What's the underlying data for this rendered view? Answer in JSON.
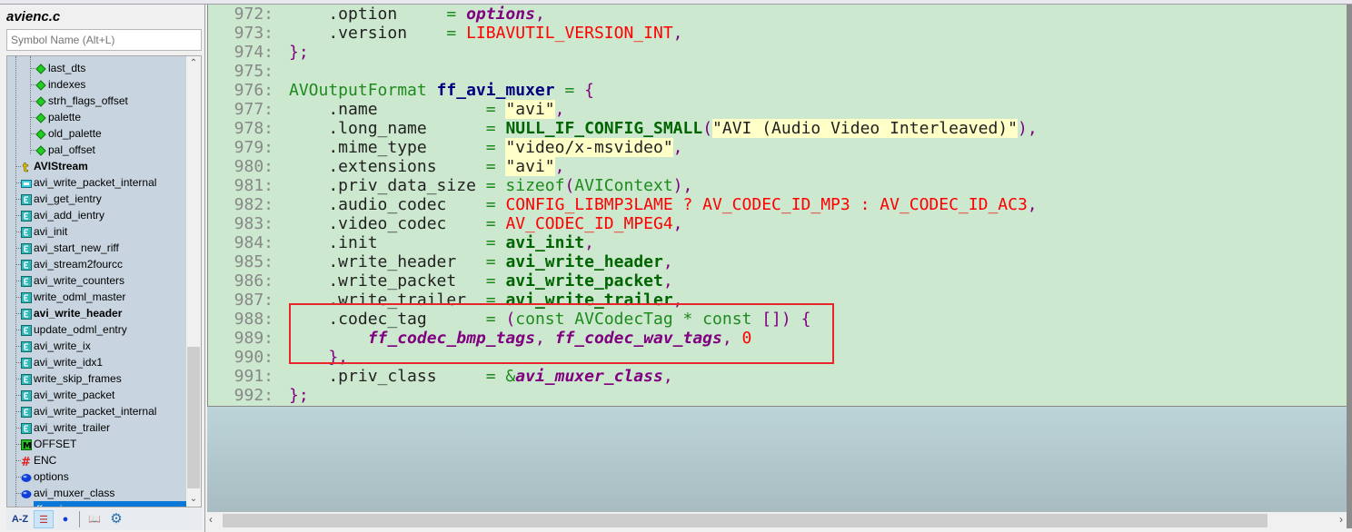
{
  "sidebar": {
    "file_title": "avienc.c",
    "search_placeholder": "Symbol Name (Alt+L)",
    "items": [
      {
        "label": "last_dts",
        "icon": "member-diamond-icon",
        "level": 2
      },
      {
        "label": "indexes",
        "icon": "member-diamond-icon",
        "level": 2
      },
      {
        "label": "strh_flags_offset",
        "icon": "member-diamond-icon",
        "level": 2
      },
      {
        "label": "palette",
        "icon": "member-diamond-icon",
        "level": 2
      },
      {
        "label": "old_palette",
        "icon": "member-diamond-icon",
        "level": 2
      },
      {
        "label": "pal_offset",
        "icon": "member-diamond-icon",
        "level": 2
      },
      {
        "label": "AVIStream",
        "icon": "struct-icon",
        "level": 1,
        "bold": true
      },
      {
        "label": "avi_write_packet_internal",
        "icon": "function-prototype-icon",
        "level": 1
      },
      {
        "label": "avi_get_ientry",
        "icon": "function-icon",
        "level": 1
      },
      {
        "label": "avi_add_ientry",
        "icon": "function-icon",
        "level": 1
      },
      {
        "label": "avi_init",
        "icon": "function-icon",
        "level": 1
      },
      {
        "label": "avi_start_new_riff",
        "icon": "function-icon",
        "level": 1
      },
      {
        "label": "avi_stream2fourcc",
        "icon": "function-icon",
        "level": 1
      },
      {
        "label": "avi_write_counters",
        "icon": "function-icon",
        "level": 1
      },
      {
        "label": "write_odml_master",
        "icon": "function-icon",
        "level": 1
      },
      {
        "label": "avi_write_header",
        "icon": "function-icon",
        "level": 1,
        "bold": true
      },
      {
        "label": "update_odml_entry",
        "icon": "function-icon",
        "level": 1
      },
      {
        "label": "avi_write_ix",
        "icon": "function-icon",
        "level": 1
      },
      {
        "label": "avi_write_idx1",
        "icon": "function-icon",
        "level": 1
      },
      {
        "label": "write_skip_frames",
        "icon": "function-icon",
        "level": 1
      },
      {
        "label": "avi_write_packet",
        "icon": "function-icon",
        "level": 1
      },
      {
        "label": "avi_write_packet_internal",
        "icon": "function-icon",
        "level": 1
      },
      {
        "label": "avi_write_trailer",
        "icon": "function-icon",
        "level": 1
      },
      {
        "label": "OFFSET",
        "icon": "macro-icon",
        "level": 1
      },
      {
        "label": "ENC",
        "icon": "define-hash-icon",
        "level": 1
      },
      {
        "label": "options",
        "icon": "variable-icon",
        "level": 1
      },
      {
        "label": "avi_muxer_class",
        "icon": "variable-icon",
        "level": 1
      },
      {
        "label": "ff_avi_muxer",
        "icon": "variable-icon",
        "level": 1,
        "selected": true
      }
    ],
    "toolbar": {
      "sort_label": "A-Z"
    }
  },
  "editor": {
    "lines": [
      {
        "num": "972:",
        "tokens": [
          [
            "    .option     ",
            "plain"
          ],
          [
            "= ",
            "type"
          ],
          [
            "options",
            "var"
          ],
          [
            ",",
            "punc"
          ]
        ]
      },
      {
        "num": "973:",
        "tokens": [
          [
            "    .version    ",
            "plain"
          ],
          [
            "= ",
            "type"
          ],
          [
            "LIBAVUTIL_VERSION_INT",
            "macro"
          ],
          [
            ",",
            "punc"
          ]
        ]
      },
      {
        "num": "974:",
        "tokens": [
          [
            "};",
            "punc"
          ]
        ]
      },
      {
        "num": "975:",
        "tokens": []
      },
      {
        "num": "976:",
        "tokens": [
          [
            "AVOutputFormat ",
            "type"
          ],
          [
            "ff_avi_muxer",
            "decl"
          ],
          [
            " = ",
            "type"
          ],
          [
            "{",
            "punc"
          ]
        ]
      },
      {
        "num": "977:",
        "tokens": [
          [
            "    .name           ",
            "plain"
          ],
          [
            "= ",
            "type"
          ],
          [
            "\"avi\"",
            "str"
          ],
          [
            ",",
            "punc"
          ]
        ]
      },
      {
        "num": "978:",
        "tokens": [
          [
            "    .long_name      ",
            "plain"
          ],
          [
            "= ",
            "type"
          ],
          [
            "NULL_IF_CONFIG_SMALL",
            "func"
          ],
          [
            "(",
            "punc"
          ],
          [
            "\"AVI (Audio Video Interleaved)\"",
            "str"
          ],
          [
            "),",
            "punc"
          ]
        ]
      },
      {
        "num": "979:",
        "tokens": [
          [
            "    .mime_type      ",
            "plain"
          ],
          [
            "= ",
            "type"
          ],
          [
            "\"video/x-msvideo\"",
            "str"
          ],
          [
            ",",
            "punc"
          ]
        ]
      },
      {
        "num": "980:",
        "tokens": [
          [
            "    .extensions     ",
            "plain"
          ],
          [
            "= ",
            "type"
          ],
          [
            "\"avi\"",
            "str"
          ],
          [
            ",",
            "punc"
          ]
        ]
      },
      {
        "num": "981:",
        "tokens": [
          [
            "    .priv_data_size ",
            "plain"
          ],
          [
            "= sizeof",
            "type"
          ],
          [
            "(",
            "punc"
          ],
          [
            "AVIContext",
            "type"
          ],
          [
            "),",
            "punc"
          ]
        ]
      },
      {
        "num": "982:",
        "tokens": [
          [
            "    .audio_codec    ",
            "plain"
          ],
          [
            "= ",
            "type"
          ],
          [
            "CONFIG_LIBMP3LAME ? AV_CODEC_ID_MP3 : AV_CODEC_ID_AC3",
            "macro"
          ],
          [
            ",",
            "punc"
          ]
        ]
      },
      {
        "num": "983:",
        "tokens": [
          [
            "    .video_codec    ",
            "plain"
          ],
          [
            "= ",
            "type"
          ],
          [
            "AV_CODEC_ID_MPEG4",
            "macro"
          ],
          [
            ",",
            "punc"
          ]
        ]
      },
      {
        "num": "984:",
        "tokens": [
          [
            "    .init           ",
            "plain"
          ],
          [
            "= ",
            "type"
          ],
          [
            "avi_init",
            "func"
          ],
          [
            ",",
            "punc"
          ]
        ]
      },
      {
        "num": "985:",
        "tokens": [
          [
            "    .write_header   ",
            "plain"
          ],
          [
            "= ",
            "type"
          ],
          [
            "avi_write_header",
            "func"
          ],
          [
            ",",
            "punc"
          ]
        ]
      },
      {
        "num": "986:",
        "tokens": [
          [
            "    .write_packet   ",
            "plain"
          ],
          [
            "= ",
            "type"
          ],
          [
            "avi_write_packet",
            "func"
          ],
          [
            ",",
            "punc"
          ]
        ]
      },
      {
        "num": "987:",
        "tokens": [
          [
            "    .write_trailer  ",
            "plain"
          ],
          [
            "= ",
            "type"
          ],
          [
            "avi_write_trailer",
            "func"
          ],
          [
            ",",
            "punc"
          ]
        ]
      },
      {
        "num": "988:",
        "tokens": [
          [
            "    .codec_tag      ",
            "plain"
          ],
          [
            "= ",
            "type"
          ],
          [
            "(",
            "punc"
          ],
          [
            "const AVCodecTag * const ",
            "type"
          ],
          [
            "[]) {",
            "punc"
          ]
        ]
      },
      {
        "num": "989:",
        "tokens": [
          [
            "        ",
            "plain"
          ],
          [
            "ff_codec_bmp_tags",
            "var"
          ],
          [
            ", ",
            "punc"
          ],
          [
            "ff_codec_wav_tags",
            "var"
          ],
          [
            ", ",
            "punc"
          ],
          [
            "0",
            "num"
          ]
        ]
      },
      {
        "num": "990:",
        "tokens": [
          [
            "    },",
            "punc"
          ]
        ]
      },
      {
        "num": "991:",
        "tokens": [
          [
            "    .priv_class     ",
            "plain"
          ],
          [
            "= &",
            "type"
          ],
          [
            "avi_muxer_class",
            "var"
          ],
          [
            ",",
            "punc"
          ]
        ]
      },
      {
        "num": "992:",
        "tokens": [
          [
            "};",
            "punc"
          ]
        ]
      }
    ]
  },
  "colors": {
    "editor_bg": "#cce8cf",
    "highlight_box": "#e8262a",
    "selection": "#0a78d7"
  }
}
